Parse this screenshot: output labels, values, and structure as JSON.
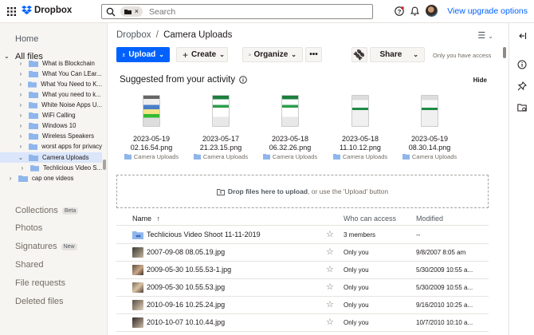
{
  "app": {
    "name": "Dropbox"
  },
  "header": {
    "search_placeholder": "Search",
    "upgrade_label": "View upgrade options"
  },
  "sidebar": {
    "home": "Home",
    "all_files": "All files",
    "tree": [
      {
        "label": "What is Blockchain",
        "expandable": true
      },
      {
        "label": "What You Can LEar...",
        "expandable": true
      },
      {
        "label": "What You Need to K...",
        "expandable": true
      },
      {
        "label": "What you need to k...",
        "expandable": true
      },
      {
        "label": "White Noise Apps U...",
        "expandable": true
      },
      {
        "label": "WiFi Calling",
        "expandable": true
      },
      {
        "label": "Windows 10",
        "expandable": true
      },
      {
        "label": "Wireless Speakers",
        "expandable": true
      },
      {
        "label": "worst apps for privacy",
        "expandable": true
      },
      {
        "label": "Camera Uploads",
        "expandable": true,
        "expanded": true,
        "selected": true
      },
      {
        "label": "Techlicious Video S...",
        "expandable": true,
        "child": true
      },
      {
        "label": "cap one videos",
        "expandable": true,
        "root": true
      }
    ],
    "collections": "Collections",
    "collections_badge": "Beta",
    "photos": "Photos",
    "signatures": "Signatures",
    "signatures_badge": "New",
    "shared": "Shared",
    "file_requests": "File requests",
    "deleted_files": "Deleted files"
  },
  "breadcrumb": {
    "parent": "Dropbox",
    "separator": "/",
    "current": "Camera Uploads"
  },
  "toolbar": {
    "upload": "Upload",
    "create": "Create",
    "organize": "Organize",
    "more": "•••",
    "share": "Share",
    "access_note": "Only you have access"
  },
  "suggested": {
    "title": "Suggested from your activity",
    "hide": "Hide",
    "items": [
      {
        "date": "2023-05-19",
        "time": "02.16.54.png",
        "folder": "Camera Uploads",
        "thumb": "a"
      },
      {
        "date": "2023-05-17",
        "time": "21.23.15.png",
        "folder": "Camera Uploads",
        "thumb": "b"
      },
      {
        "date": "2023-05-18",
        "time": "06.32.26.png",
        "folder": "Camera Uploads",
        "thumb": "b"
      },
      {
        "date": "2023-05-18",
        "time": "11.10.12.png",
        "folder": "Camera Uploads",
        "thumb": "c"
      },
      {
        "date": "2023-05-19",
        "time": "08.30.14.png",
        "folder": "Camera Uploads",
        "thumb": "c"
      }
    ]
  },
  "dropzone": {
    "bold": "Drop files here to upload",
    "rest": ", or use the 'Upload' button"
  },
  "table": {
    "columns": {
      "name": "Name",
      "sort_arrow": "↑",
      "access": "Who can access",
      "modified": "Modified"
    },
    "rows": [
      {
        "name": "Techlicious Video Shoot 11-11-2019",
        "type": "folder",
        "access": "3 members",
        "modified": "--"
      },
      {
        "name": "2007-09-08 08.05.19.jpg",
        "type": "photo1",
        "access": "Only you",
        "modified": "9/8/2007 8:05 am"
      },
      {
        "name": "2009-05-30 10.55.53-1.jpg",
        "type": "photo2",
        "access": "Only you",
        "modified": "5/30/2009 10:55 a..."
      },
      {
        "name": "2009-05-30 10.55.53.jpg",
        "type": "photo3",
        "access": "Only you",
        "modified": "5/30/2009 10:55 a..."
      },
      {
        "name": "2010-09-16 10.25.24.jpg",
        "type": "photo4",
        "access": "Only you",
        "modified": "9/16/2010 10:25 a..."
      },
      {
        "name": "2010-10-07 10.10.44.jpg",
        "type": "photo5",
        "access": "Only you",
        "modified": "10/7/2010 10:10 a..."
      }
    ]
  },
  "colors": {
    "accent": "#0061fe",
    "sidebar_bg": "#f7f5f2",
    "selected": "#dbe6fb",
    "folder": "#8fb6ec"
  }
}
